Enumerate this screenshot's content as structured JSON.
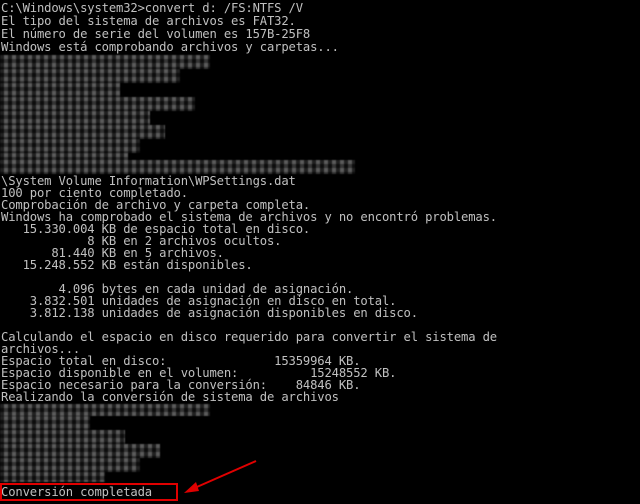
{
  "console": {
    "lines": [
      "C:\\Windows\\system32>convert d: /FS:NTFS /V",
      "El tipo del sistema de archivos es FAT32.",
      "El número de serie del volumen es 157B-25F8",
      "Windows está comprobando archivos y carpetas...",
      "\\System Volume Information\\WPSettings.dat",
      "100 por ciento completado.",
      "Comprobación de archivo y carpeta completa.",
      "Windows ha comprobado el sistema de archivos y no encontró problemas.",
      "   15.330.004 KB de espacio total en disco.",
      "            8 KB en 2 archivos ocultos.",
      "       81.440 KB en 5 archivos.",
      "   15.248.552 KB están disponibles.",
      "",
      "        4.096 bytes en cada unidad de asignación.",
      "    3.832.501 unidades de asignación en disco en total.",
      "    3.812.138 unidades de asignación disponibles en disco.",
      "",
      "Calculando el espacio en disco requerido para convertir el sistema de",
      "archivos...",
      "Espacio total en disco:               15359964 KB.",
      "Espacio disponible en el volumen:          15248552 KB.",
      "Espacio necesario para la conversión:    84846 KB.",
      "Realizando la conversión de sistema de archivos",
      "Conversión completada"
    ]
  },
  "colors": {
    "background": "#000000",
    "text": "#c0c0c0",
    "highlight": "#e00000"
  }
}
